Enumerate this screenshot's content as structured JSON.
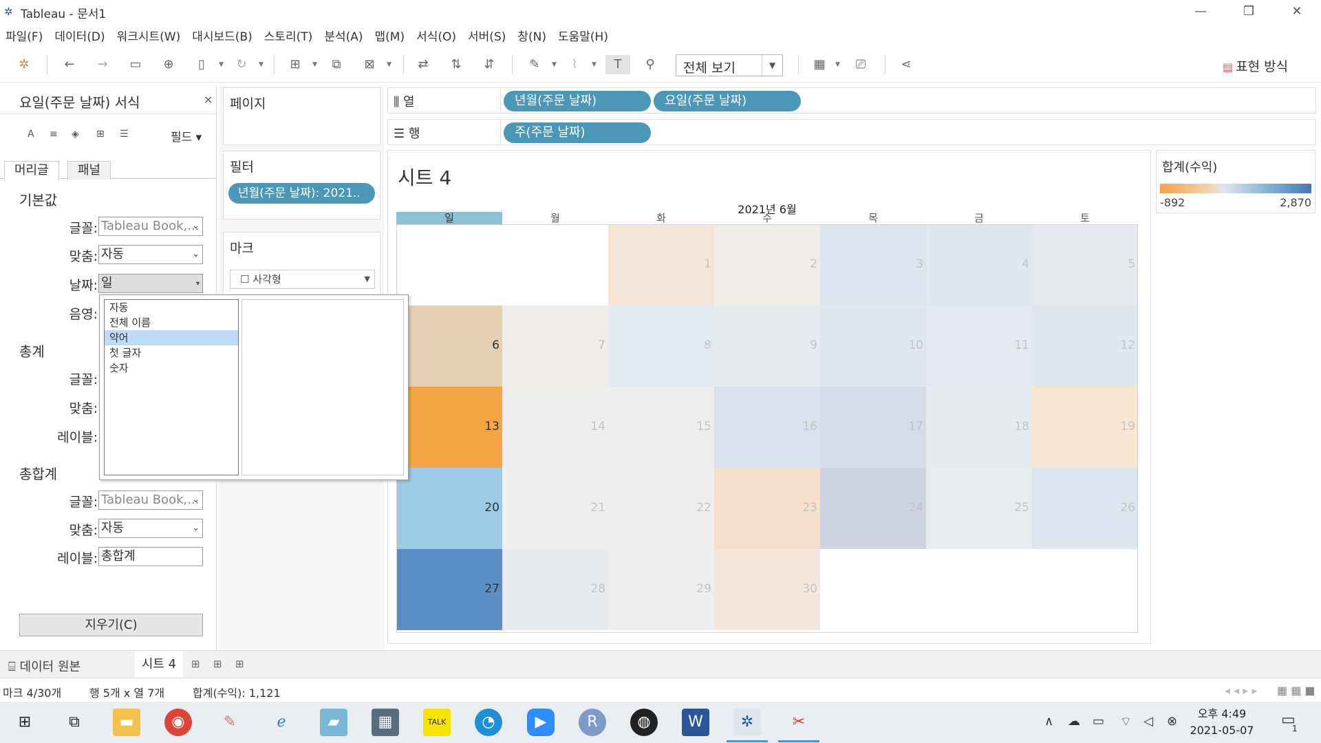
{
  "window": {
    "title": "Tableau - 문서1"
  },
  "menu": [
    "파일(F)",
    "데이터(D)",
    "워크시트(W)",
    "대시보드(B)",
    "스토리(T)",
    "분석(A)",
    "맵(M)",
    "서식(O)",
    "서버(S)",
    "창(N)",
    "도움말(H)"
  ],
  "toolbar": {
    "view_mode": "전체 보기",
    "show_me": "표현 방식"
  },
  "format_pane": {
    "title": "요일(주문 날짜) 서식",
    "field_menu": "필드",
    "tabs": [
      "머리글",
      "패널"
    ],
    "sections": {
      "default": {
        "head": "기본값",
        "font_label": "글꼴:",
        "font_value": "Tableau Book,...",
        "align_label": "맞춤:",
        "align_value": "자동",
        "dates_label": "날짜:",
        "dates_value": "일",
        "shading_label": "음영:"
      },
      "totals": {
        "head": "총계",
        "font_label": "글꼴:",
        "align_label": "맞춤:",
        "label_label": "레이블:"
      },
      "grand_totals": {
        "head": "총합계",
        "font_label": "글꼴:",
        "font_value": "Tableau Book,...",
        "align_label": "맞춤:",
        "align_value": "자동",
        "label_label": "레이블:",
        "label_value": "총합계"
      }
    },
    "clear_button": "지우기(C)",
    "date_options": [
      "자동",
      "전체 이름",
      "약어",
      "첫 글자",
      "숫자"
    ],
    "date_selected_index": 2
  },
  "cards": {
    "pages": "페이지",
    "filters": "필터",
    "filter_pill": "년월(주문 날짜): 2021..",
    "marks": "마크",
    "mark_type": "사각형"
  },
  "shelves": {
    "columns_label": "열",
    "columns_pills": [
      "년월(주문 날짜)",
      "요일(주문 날짜)"
    ],
    "rows_label": "행",
    "rows_pills": [
      "주(주문 날짜)"
    ]
  },
  "view": {
    "sheet_title": "시트 4",
    "legend_title": "합계(수익)",
    "legend_min": "-892",
    "legend_max": "2,870"
  },
  "chart_data": {
    "type": "heatmap",
    "title": "2021년 6월",
    "columns": [
      "일",
      "월",
      "화",
      "수",
      "목",
      "금",
      "토"
    ],
    "highlighted_column": "일",
    "weeks": [
      [
        null,
        null,
        1,
        2,
        3,
        4,
        5
      ],
      [
        6,
        7,
        8,
        9,
        10,
        11,
        12
      ],
      [
        13,
        14,
        15,
        16,
        17,
        18,
        19
      ],
      [
        20,
        21,
        22,
        23,
        24,
        25,
        26
      ],
      [
        27,
        28,
        29,
        30,
        null,
        null,
        null
      ]
    ],
    "cell_colors": [
      [
        null,
        null,
        "#f3e6d6",
        "#f0ede9",
        "#dce5ee",
        "#dfe7ef",
        "#e6e9ed"
      ],
      [
        "#e3cfb2",
        "#f0ece7",
        "#e3eaf1",
        "#e6ebf0",
        "#dfe6ee",
        "#e4e9ef",
        "#dfe7ef"
      ],
      [
        "#f5a446",
        "#eeeeed",
        "#eeeeee",
        "#d8e1ec",
        "#d5dce7",
        "#e6ebf0",
        "#f6e6d2"
      ],
      [
        "#9dcae4",
        "#eeeeee",
        "#eeeeee",
        "#f5e0cb",
        "#cdd4df",
        "#e9ecef",
        "#dde6ee"
      ],
      [
        "#5b8ec2",
        "#e6ebf0",
        "#eeeeee",
        "#f3e8dd",
        null,
        null,
        null
      ]
    ],
    "legend": {
      "title": "합계(수익)",
      "min": -892,
      "max": 2870
    }
  },
  "sheet_tabs": {
    "data_source": "데이터 원본",
    "active_sheet": "시트 4"
  },
  "status": {
    "marks": "마크 4/30개",
    "dims": "행 5개 x 열 7개",
    "sum": "합계(수익): 1,121"
  },
  "taskbar": {
    "time": "오후 4:49",
    "date": "2021-05-07",
    "notifications": "1"
  }
}
